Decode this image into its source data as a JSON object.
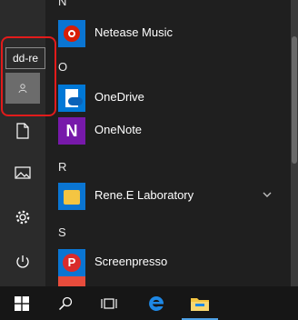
{
  "colors": {
    "accent": "#0a75d2",
    "highlight": "#e21b1b",
    "taskbar": "#161616"
  },
  "start_menu": {
    "groups": [
      {
        "letter": "N"
      },
      {
        "letter": "O"
      },
      {
        "letter": "R"
      },
      {
        "letter": "S"
      }
    ],
    "apps": [
      {
        "name": "Netease Music",
        "icon": "netease-music-icon"
      },
      {
        "name": "OneDrive",
        "icon": "onedrive-icon"
      },
      {
        "name": "OneNote",
        "icon": "onenote-icon"
      },
      {
        "name": "Rene.E Laboratory",
        "icon": "folder-icon",
        "expandable": true
      },
      {
        "name": "Screenpresso",
        "icon": "screenpresso-icon"
      }
    ],
    "onenote_glyph": "N",
    "screenpresso_glyph": "P"
  },
  "rail": {
    "user_tooltip": "dd-re",
    "items": [
      "user-avatar",
      "documents",
      "pictures",
      "settings",
      "power"
    ]
  },
  "taskbar": {
    "items": [
      "start",
      "search",
      "task-view",
      "edge",
      "file-explorer"
    ],
    "active": "file-explorer"
  }
}
